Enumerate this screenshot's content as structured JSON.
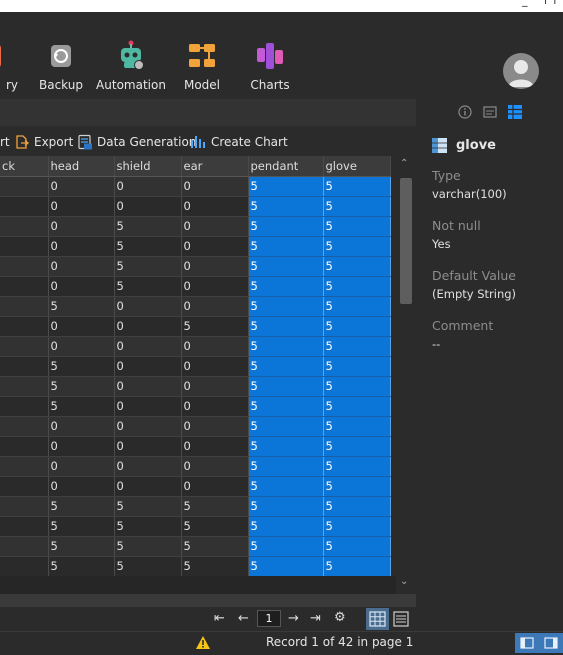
{
  "toolbar": {
    "items": [
      {
        "label": "ry"
      },
      {
        "label": "Backup"
      },
      {
        "label": "Automation"
      },
      {
        "label": "Model"
      },
      {
        "label": "Charts"
      }
    ]
  },
  "actions": {
    "partial_label": "rt",
    "export_label": "Export",
    "data_generation_label": "Data Generation",
    "create_chart_label": "Create Chart"
  },
  "grid": {
    "columns": [
      "ck",
      "head",
      "shield",
      "ear",
      "pendant",
      "glove"
    ],
    "rows": [
      [
        "",
        "0",
        "0",
        "0",
        "5",
        "5"
      ],
      [
        "",
        "0",
        "0",
        "0",
        "5",
        "5"
      ],
      [
        "",
        "0",
        "5",
        "0",
        "5",
        "5"
      ],
      [
        "",
        "0",
        "5",
        "0",
        "5",
        "5"
      ],
      [
        "",
        "0",
        "5",
        "0",
        "5",
        "5"
      ],
      [
        "",
        "0",
        "5",
        "0",
        "5",
        "5"
      ],
      [
        "",
        "5",
        "0",
        "0",
        "5",
        "5"
      ],
      [
        "",
        "0",
        "0",
        "5",
        "5",
        "5"
      ],
      [
        "",
        "0",
        "0",
        "0",
        "5",
        "5"
      ],
      [
        "",
        "5",
        "0",
        "0",
        "5",
        "5"
      ],
      [
        "",
        "5",
        "0",
        "0",
        "5",
        "5"
      ],
      [
        "",
        "5",
        "0",
        "0",
        "5",
        "5"
      ],
      [
        "",
        "0",
        "0",
        "0",
        "5",
        "5"
      ],
      [
        "",
        "0",
        "0",
        "0",
        "5",
        "5"
      ],
      [
        "",
        "0",
        "0",
        "0",
        "5",
        "5"
      ],
      [
        "",
        "0",
        "0",
        "0",
        "5",
        "5"
      ],
      [
        "",
        "5",
        "5",
        "5",
        "5",
        "5"
      ],
      [
        "",
        "5",
        "5",
        "5",
        "5",
        "5"
      ],
      [
        "",
        "5",
        "5",
        "5",
        "5",
        "5"
      ],
      [
        "",
        "5",
        "5",
        "5",
        "5",
        "5"
      ]
    ]
  },
  "pager": {
    "page": "1"
  },
  "status": {
    "record_text": "Record 1 of 42 in page 1"
  },
  "side_panel": {
    "field_name": "glove",
    "type_label": "Type",
    "type_value": "varchar(100)",
    "not_null_label": "Not null",
    "not_null_value": "Yes",
    "default_label": "Default Value",
    "default_value": "(Empty String)",
    "comment_label": "Comment",
    "comment_value": "--"
  },
  "colors": {
    "selection": "#0b76d8",
    "background": "#2b2b2b",
    "accent": "#1e90ff",
    "warning": "#f5c518"
  }
}
